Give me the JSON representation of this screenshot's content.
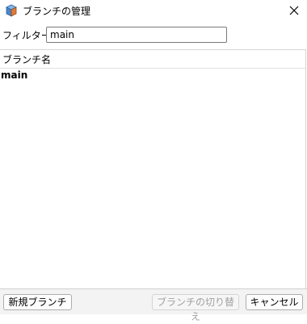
{
  "window": {
    "title": "ブランチの管理",
    "app_icon": "app-cube-icon",
    "close_icon": "close-icon"
  },
  "filter": {
    "label": "フィルター:",
    "value": "main"
  },
  "branch_list": {
    "column_header": "ブランチ名",
    "rows": [
      "main"
    ]
  },
  "footer": {
    "new_branch_label": "新規ブランチ",
    "switch_branch_label": "ブランチの切り替え",
    "cancel_label": "キャンセル"
  },
  "colors": {
    "disabled_text": "#a0a0a0",
    "footer_bg": "#f3f3f3"
  }
}
